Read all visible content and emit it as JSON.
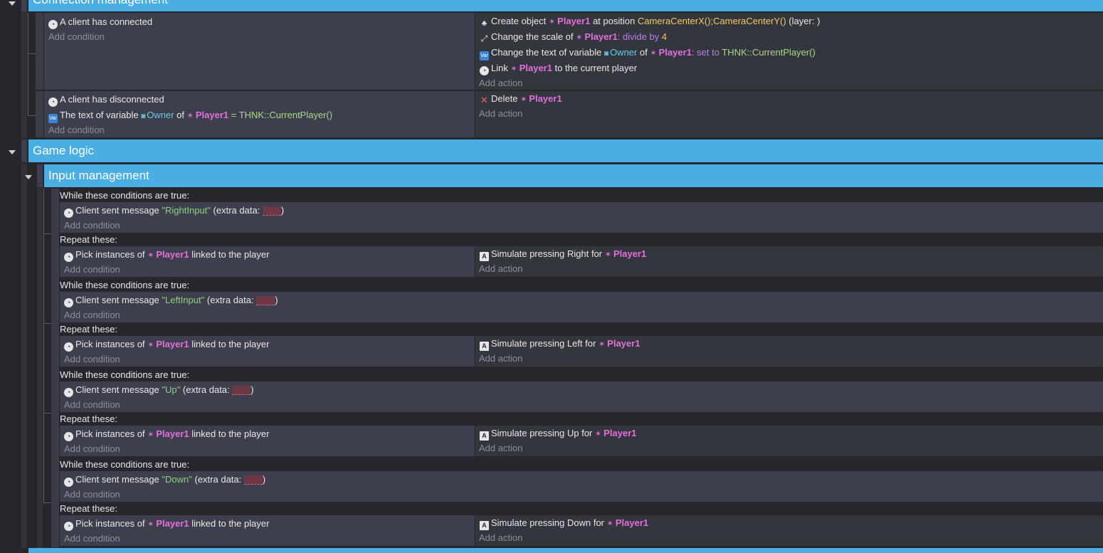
{
  "groups": {
    "connection": "Connection management",
    "game_logic": "Game logic",
    "input": "Input management"
  },
  "common": {
    "add_condition": "Add condition",
    "add_action": "Add action",
    "player": "Player1",
    "while_label": "While these conditions are true:",
    "repeat_label": "Repeat these:",
    "pick_prefix": "Pick instances of",
    "pick_suffix": "linked to the player",
    "msg_prefix": "Client sent message",
    "extra_open": "(extra data:",
    "extra_close": ")",
    "simulate_prefix": "Simulate pressing",
    "for_word": "for"
  },
  "event1": {
    "condition": "A client has connected",
    "create": {
      "prefix": "Create object",
      "at": "at position",
      "pos": "CameraCenterX();CameraCenterY()",
      "layer": "(layer: )"
    },
    "scale": {
      "prefix": "Change the scale of",
      "op": ": divide by",
      "value": "4"
    },
    "text": {
      "prefix": "Change the text of variable",
      "var": "Owner",
      "of": "of",
      "op": ": set to",
      "value": "THNK::CurrentPlayer()"
    },
    "link": {
      "prefix": "Link",
      "suffix": "to the current player"
    }
  },
  "event2": {
    "cond1": "A client has disconnected",
    "cond2": {
      "prefix": "The text of variable",
      "var": "Owner",
      "of": "of",
      "op": "=",
      "value": "THNK::CurrentPlayer()"
    },
    "delete": "Delete"
  },
  "inputs": [
    {
      "message": "\"RightInput\"",
      "key": "Right"
    },
    {
      "message": "\"LeftInput\"",
      "key": "Left"
    },
    {
      "message": "\"Up\"",
      "key": "Up"
    },
    {
      "message": "\"Down\"",
      "key": "Down"
    }
  ]
}
